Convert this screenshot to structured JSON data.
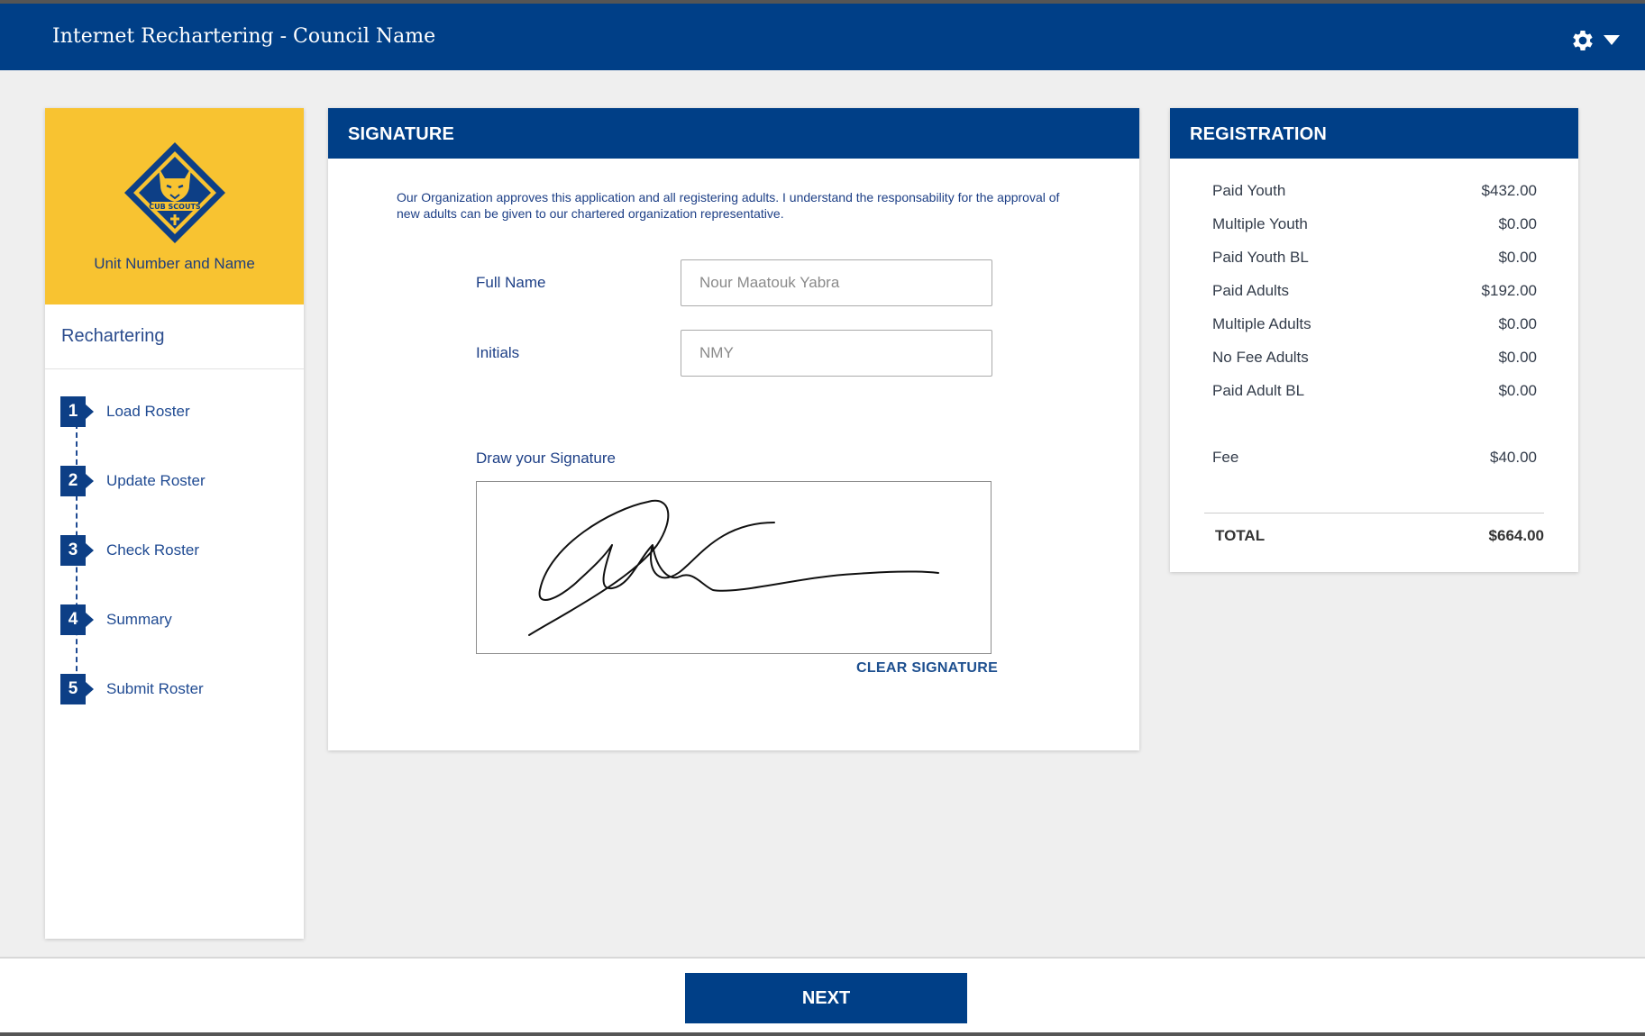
{
  "app": {
    "title": "Internet Rechartering - Council Name"
  },
  "icons": {
    "settings": "gear-icon",
    "settings_caret": "caret-down-icon",
    "unit_logo": "cub-scouts-logo"
  },
  "colors": {
    "brand_blue": "#003f87",
    "unit_yellow": "#f8c331",
    "background": "#efefef"
  },
  "sidebar": {
    "unit_name": "Unit Number and Name",
    "section_title": "Rechartering",
    "steps": [
      {
        "number": "1",
        "label": "Load Roster"
      },
      {
        "number": "2",
        "label": "Update Roster"
      },
      {
        "number": "3",
        "label": "Check Roster"
      },
      {
        "number": "4",
        "label": "Summary"
      },
      {
        "number": "5",
        "label": "Submit Roster"
      }
    ]
  },
  "signature": {
    "header": "SIGNATURE",
    "consent_text": "Our Organization approves this application and all registering adults. I understand the responsability for the approval of new adults can be given to our chartered organization representative.",
    "full_name_label": "Full Name",
    "full_name_value": "Nour Maatouk Yabra",
    "initials_label": "Initials",
    "initials_value": "NMY",
    "draw_label": "Draw your Signature",
    "clear_label": "CLEAR SIGNATURE"
  },
  "registration": {
    "header": "REGISTRATION",
    "rows": [
      {
        "label": "Paid Youth",
        "value": "$432.00"
      },
      {
        "label": "Multiple Youth",
        "value": "$0.00"
      },
      {
        "label": "Paid Youth BL",
        "value": "$0.00"
      },
      {
        "label": "Paid Adults",
        "value": "$192.00"
      },
      {
        "label": "Multiple Adults",
        "value": "$0.00"
      },
      {
        "label": "No Fee Adults",
        "value": "$0.00"
      },
      {
        "label": "Paid Adult BL",
        "value": "$0.00"
      }
    ],
    "fee_label": "Fee",
    "fee_value": "$40.00",
    "total_label": "TOTAL",
    "total_value": "$664.00"
  },
  "footer": {
    "next_label": "NEXT"
  }
}
